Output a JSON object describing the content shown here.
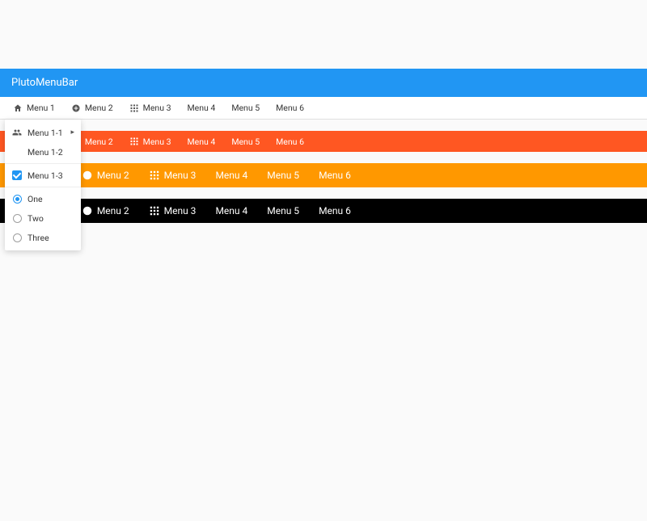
{
  "header": {
    "title": "PlutoMenuBar"
  },
  "menus": {
    "items": [
      {
        "label": "Menu 1",
        "icon": "home"
      },
      {
        "label": "Menu 2",
        "icon": "add-circle"
      },
      {
        "label": "Menu 3",
        "icon": "apps"
      },
      {
        "label": "Menu 4"
      },
      {
        "label": "Menu 5"
      },
      {
        "label": "Menu 6"
      }
    ]
  },
  "dropdown": {
    "items": [
      {
        "label": "Menu 1-1",
        "icon": "people",
        "submenu": true
      },
      {
        "label": "Menu 1-2"
      },
      {
        "label": "Menu 1-3",
        "type": "checkbox",
        "checked": true
      },
      {
        "label": "One",
        "type": "radio",
        "checked": true
      },
      {
        "label": "Two",
        "type": "radio",
        "checked": false
      },
      {
        "label": "Three",
        "type": "radio",
        "checked": false
      }
    ]
  },
  "colors": {
    "primary": "#2196f3",
    "bar_a": "#ff5722",
    "bar_b": "#ff9800",
    "bar_c": "#000000"
  }
}
